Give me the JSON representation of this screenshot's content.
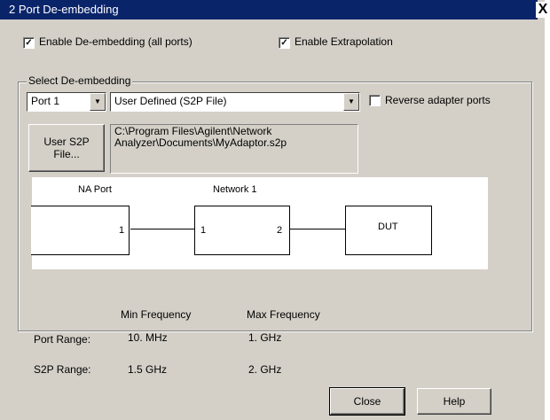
{
  "window": {
    "title": "2 Port De-embedding",
    "close_glyph": "X"
  },
  "options": {
    "enable_deembedding": {
      "label": "Enable De-embedding (all ports)",
      "checked": true
    },
    "enable_extrapolation": {
      "label": "Enable Extrapolation",
      "checked": true
    }
  },
  "select_group": {
    "title": "Select De-embedding",
    "port_select": "Port 1",
    "type_select": "User Defined (S2P File)",
    "reverse_adapter": {
      "label": "Reverse adapter ports",
      "checked": false
    },
    "user_s2p_button": {
      "line1": "User S2P",
      "line2": "File..."
    },
    "file_path": {
      "line1": "C:\\Program Files\\Agilent\\Network",
      "line2": "Analyzer\\Documents\\MyAdaptor.s2p"
    }
  },
  "diagram": {
    "na_port_label": "NA Port",
    "na_port_pin": "1",
    "network_label": "Network 1",
    "network_pin_left": "1",
    "network_pin_right": "2",
    "dut_label": "DUT"
  },
  "frequency_table": {
    "min_header": "Min Frequency",
    "max_header": "Max Frequency",
    "rows": [
      {
        "label": "Port Range:",
        "min": "10. MHz",
        "max": "1. GHz"
      },
      {
        "label": "S2P Range:",
        "min": "1.5 GHz",
        "max": "2. GHz"
      }
    ]
  },
  "buttons": {
    "close": "Close",
    "help": "Help"
  }
}
